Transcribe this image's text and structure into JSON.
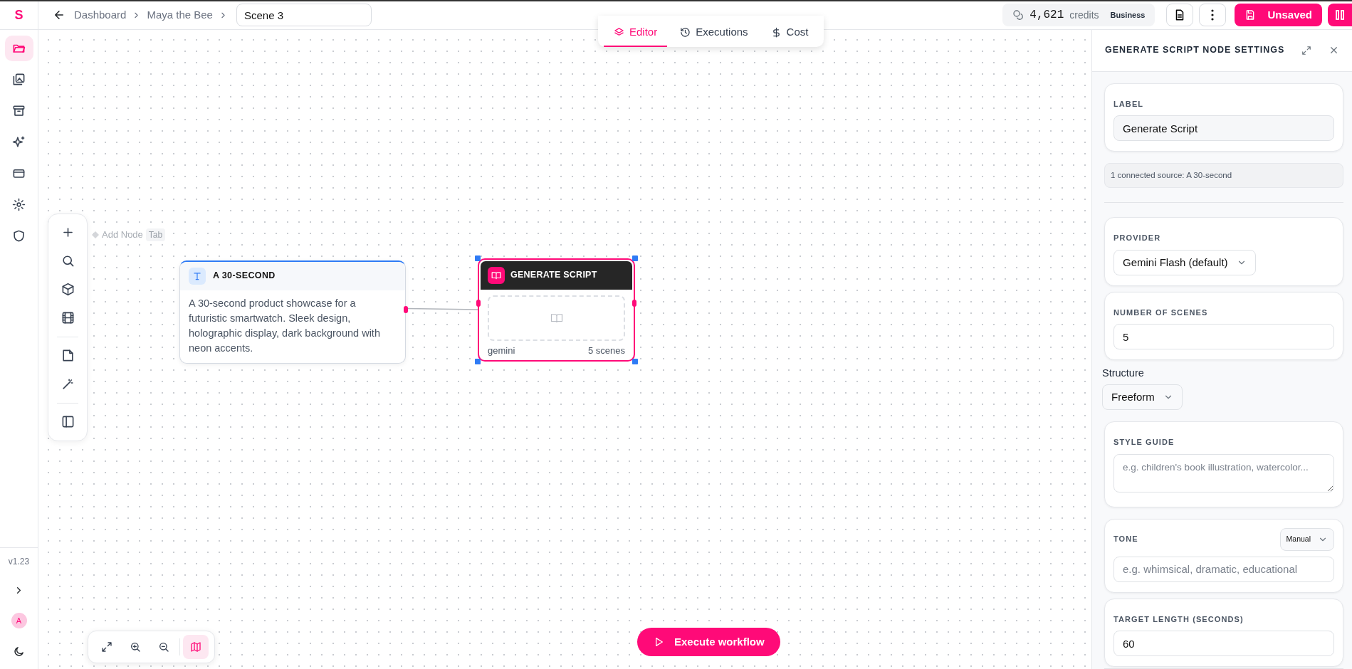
{
  "app": {
    "logo": "S",
    "version": "v1.23",
    "avatar": "A"
  },
  "sidebar": {
    "items": [
      {
        "selected": true
      },
      {
        "selected": false
      },
      {
        "selected": false
      },
      {
        "selected": false
      },
      {
        "selected": false
      },
      {
        "selected": false
      },
      {
        "selected": false
      }
    ]
  },
  "topbar": {
    "breadcrumbs": [
      "Dashboard",
      "Maya the Bee"
    ],
    "scene_name": "Scene 3",
    "credits": "4,621",
    "credits_label": "credits",
    "plan": "Business",
    "save_button": "Unsaved"
  },
  "tabs": [
    {
      "label": "Editor",
      "selected": true
    },
    {
      "label": "Executions",
      "selected": false
    },
    {
      "label": "Cost",
      "selected": false
    }
  ],
  "canvas": {
    "add_node_hint": {
      "label": "Add Node",
      "shortcut": "Tab"
    },
    "nodes": [
      {
        "kind": "text",
        "title": "A 30-SECOND",
        "body": "A 30-second product showcase for a futuristic smartwatch. Sleek design, holographic display, dark background with neon accents.",
        "selected": false
      },
      {
        "kind": "script",
        "title": "GENERATE SCRIPT",
        "provider": "gemini",
        "scenes": "5 scenes",
        "selected": true
      }
    ],
    "minimap_on": true,
    "execute_button": "Execute workflow"
  },
  "panel": {
    "title": "GENERATE SCRIPT NODE SETTINGS",
    "label": {
      "heading": "LABEL",
      "value": "Generate Script"
    },
    "connected_source": "1 connected source: A 30-second",
    "provider": {
      "heading": "PROVIDER",
      "value": "Gemini Flash (default)"
    },
    "scenes": {
      "heading": "NUMBER OF SCENES",
      "value": "5"
    },
    "structure": {
      "heading": "Structure",
      "value": "Freeform"
    },
    "style_guide": {
      "heading": "STYLE GUIDE",
      "placeholder": "e.g. children's book illustration, watercolor..."
    },
    "tone": {
      "heading": "TONE",
      "mode": "Manual",
      "placeholder": "e.g. whimsical, dramatic, educational"
    },
    "target_length": {
      "heading": "TARGET LENGTH (SECONDS)",
      "value": "60"
    }
  }
}
